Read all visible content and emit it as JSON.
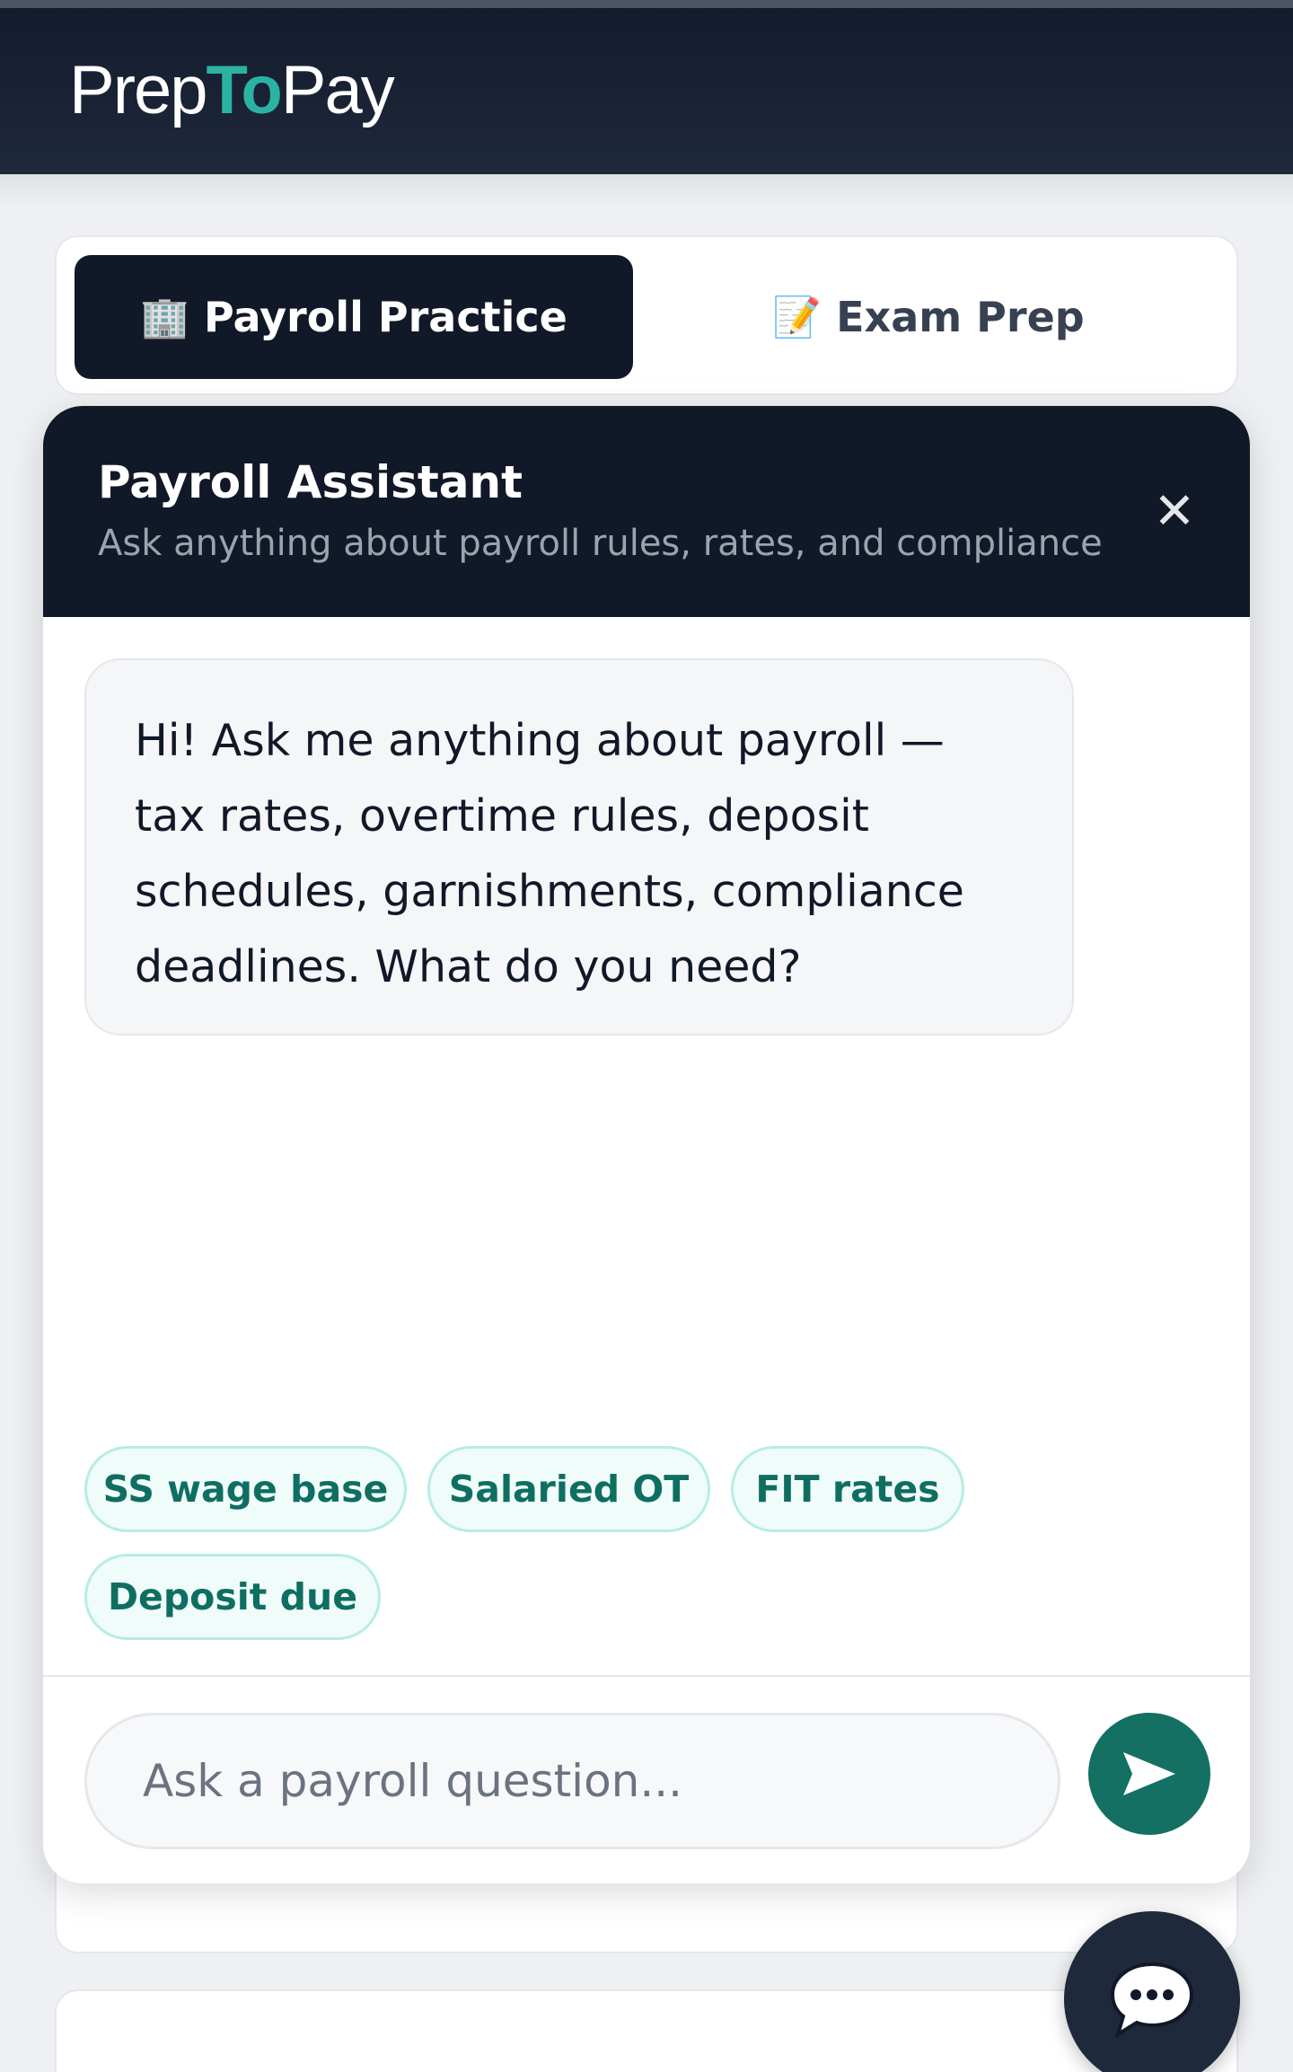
{
  "brand": {
    "prefix": "Prep",
    "highlight": "To",
    "suffix": "Pay"
  },
  "tabs": [
    {
      "icon": "🏢",
      "label": "Payroll Practice",
      "active": true
    },
    {
      "icon": "📝",
      "label": "Exam Prep",
      "active": false
    }
  ],
  "chat": {
    "title": "Payroll Assistant",
    "subtitle": "Ask anything about payroll rules, rates, and compliance",
    "close_icon": "✕",
    "messages": [
      {
        "role": "assistant",
        "text": "Hi! Ask me anything about payroll — tax rates, overtime rules, deposit schedules, garnishments, compliance deadlines. What do you need?"
      }
    ],
    "suggestions": [
      "SS wage base",
      "Salaried OT",
      "FIT rates",
      "Deposit due"
    ],
    "input": {
      "placeholder": "Ask a payroll question...",
      "value": ""
    }
  },
  "colors": {
    "brand_accent": "#2ab3a3",
    "header_bg": "#141b2e",
    "send_button": "#137062",
    "chip_text": "#0f6e62"
  }
}
